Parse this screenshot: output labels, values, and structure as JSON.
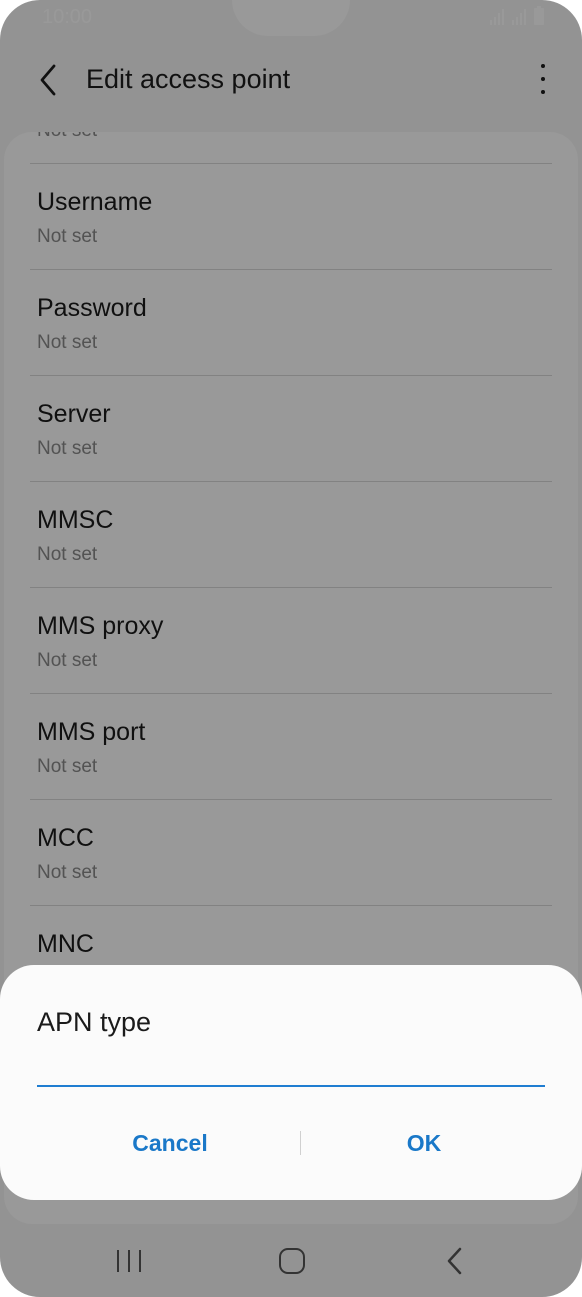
{
  "status_bar": {
    "time": "10:00",
    "icons": [
      "signal-icon",
      "signal-icon",
      "battery-icon"
    ]
  },
  "app_bar": {
    "title": "Edit access point",
    "back_icon": "chevron-left-icon",
    "more_icon": "more-vertical-icon"
  },
  "settings": {
    "partial_top_value": "Not set",
    "items": [
      {
        "title": "Username",
        "value": "Not set"
      },
      {
        "title": "Password",
        "value": "Not set"
      },
      {
        "title": "Server",
        "value": "Not set"
      },
      {
        "title": "MMSC",
        "value": "Not set"
      },
      {
        "title": "MMS proxy",
        "value": "Not set"
      },
      {
        "title": "MMS port",
        "value": "Not set"
      },
      {
        "title": "MCC",
        "value": "Not set"
      },
      {
        "title": "MNC",
        "value": ""
      }
    ]
  },
  "dialog": {
    "title": "APN type",
    "input_value": "",
    "cancel_label": "Cancel",
    "ok_label": "OK"
  },
  "nav_bar": {
    "icons": [
      "recent-apps-icon",
      "home-icon",
      "back-icon"
    ]
  },
  "colors": {
    "accent": "#1f7dd1",
    "button_text": "#1a78c8",
    "scrim": "rgba(0,0,0,0.40)"
  }
}
